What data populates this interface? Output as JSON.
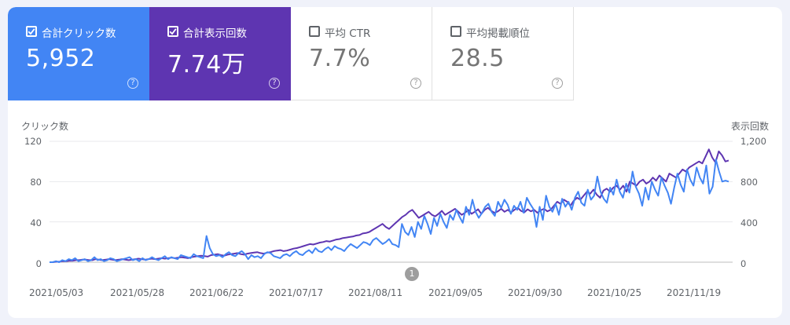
{
  "tiles": [
    {
      "label": "合計クリック数",
      "value": "5,952",
      "checked": true
    },
    {
      "label": "合計表示回数",
      "value": "7.74万",
      "checked": true
    },
    {
      "label": "平均 CTR",
      "value": "7.7%",
      "checked": false
    },
    {
      "label": "平均掲載順位",
      "value": "28.5",
      "checked": false
    }
  ],
  "help_glyph": "?",
  "chart": {
    "left_axis_title": "クリック数",
    "right_axis_title": "表示回数",
    "left_ticks": [
      "120",
      "80",
      "40",
      "0"
    ],
    "right_ticks": [
      "1,200",
      "800",
      "400",
      "0"
    ],
    "x_ticks": [
      "2021/05/03",
      "2021/05/28",
      "2021/06/22",
      "2021/07/17",
      "2021/08/11",
      "2021/09/05",
      "2021/09/30",
      "2021/10/25",
      "2021/11/19"
    ],
    "annotation_label": "1",
    "colors": {
      "clicks": "#4285f4",
      "impressions": "#5e35b1",
      "grid": "#e8eaed"
    }
  },
  "chart_data": {
    "type": "line",
    "x_start": "2021/05/03",
    "x_end": "2021/11/24",
    "ylim_left": [
      0,
      120
    ],
    "ylim_right": [
      0,
      1200
    ],
    "series": [
      {
        "name": "合計クリック数",
        "axis": "left",
        "values": [
          0,
          0,
          1,
          0,
          2,
          1,
          3,
          2,
          4,
          1,
          2,
          3,
          1,
          2,
          5,
          2,
          3,
          1,
          2,
          4,
          3,
          1,
          2,
          3,
          4,
          5,
          2,
          3,
          1,
          4,
          2,
          3,
          5,
          3,
          2,
          4,
          6,
          3,
          5,
          4,
          3,
          7,
          6,
          5,
          4,
          8,
          6,
          5,
          4,
          26,
          14,
          8,
          6,
          7,
          5,
          8,
          10,
          7,
          6,
          9,
          11,
          8,
          3,
          7,
          5,
          6,
          4,
          8,
          10,
          9,
          6,
          5,
          4,
          7,
          8,
          6,
          9,
          11,
          8,
          7,
          10,
          12,
          9,
          14,
          11,
          10,
          13,
          15,
          12,
          16,
          14,
          13,
          11,
          15,
          18,
          16,
          14,
          17,
          20,
          19,
          17,
          22,
          24,
          21,
          18,
          20,
          23,
          18,
          17,
          15,
          38,
          30,
          27,
          35,
          25,
          40,
          33,
          46,
          38,
          28,
          44,
          36,
          48,
          40,
          34,
          47,
          42,
          52,
          45,
          39,
          55,
          47,
          62,
          50,
          44,
          49,
          55,
          58,
          50,
          46,
          60,
          54,
          62,
          57,
          48,
          56,
          52,
          60,
          49,
          64,
          58,
          53,
          35,
          55,
          42,
          66,
          55,
          50,
          58,
          47,
          63,
          55,
          60,
          52,
          64,
          70,
          59,
          56,
          72,
          62,
          66,
          85,
          70,
          63,
          59,
          74,
          67,
          82,
          70,
          64,
          78,
          69,
          90,
          75,
          68,
          56,
          74,
          62,
          80,
          72,
          66,
          84,
          76,
          69,
          58,
          74,
          88,
          77,
          70,
          92,
          82,
          76,
          94,
          84,
          78,
          96,
          68,
          75,
          102,
          90,
          80,
          81,
          80
        ]
      },
      {
        "name": "合計表示回数",
        "axis": "right",
        "values": [
          0,
          0,
          5,
          5,
          10,
          10,
          15,
          15,
          20,
          20,
          25,
          25,
          20,
          20,
          30,
          25,
          20,
          25,
          30,
          25,
          20,
          25,
          30,
          25,
          20,
          25,
          30,
          35,
          30,
          25,
          30,
          35,
          30,
          35,
          40,
          35,
          40,
          45,
          40,
          45,
          50,
          45,
          40,
          50,
          55,
          60,
          65,
          60,
          55,
          70,
          75,
          80,
          70,
          65,
          75,
          80,
          85,
          90,
          80,
          75,
          85,
          90,
          95,
          100,
          90,
          85,
          95,
          100,
          110,
          115,
          120,
          110,
          115,
          125,
          135,
          140,
          150,
          160,
          170,
          180,
          175,
          185,
          195,
          200,
          210,
          205,
          215,
          225,
          230,
          240,
          245,
          250,
          255,
          265,
          270,
          285,
          290,
          300,
          320,
          340,
          360,
          380,
          350,
          330,
          360,
          390,
          420,
          450,
          470,
          500,
          520,
          480,
          440,
          460,
          480,
          500,
          470,
          455,
          480,
          510,
          470,
          490,
          510,
          530,
          500,
          470,
          490,
          520,
          480,
          500,
          525,
          480,
          520,
          540,
          510,
          490,
          505,
          530,
          500,
          520,
          495,
          520,
          540,
          510,
          495,
          525,
          505,
          520,
          490,
          515,
          530,
          505,
          520,
          560,
          600,
          580,
          620,
          600,
          560,
          610,
          640,
          620,
          660,
          700,
          680,
          720,
          670,
          640,
          710,
          730,
          700,
          740,
          760,
          720,
          760,
          700,
          800,
          780,
          760,
          800,
          820,
          780,
          800,
          840,
          810,
          860,
          830,
          800,
          880,
          860,
          840,
          880,
          920,
          900,
          940,
          960,
          980,
          1000,
          980,
          1050,
          1120,
          1040,
          990,
          1100,
          1060,
          1000,
          1010
        ]
      }
    ]
  }
}
